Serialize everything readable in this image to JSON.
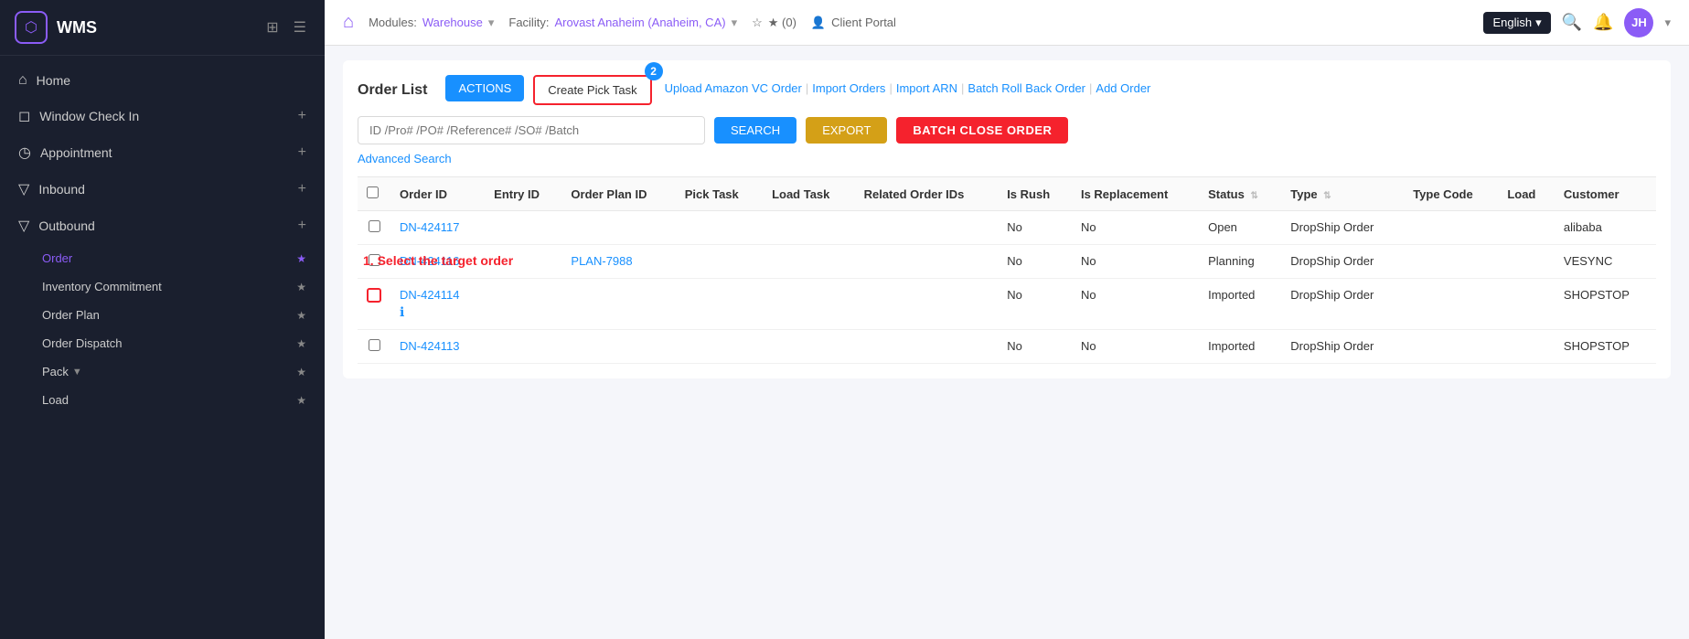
{
  "sidebar": {
    "logo_char": "⬡",
    "title": "WMS",
    "nav": [
      {
        "id": "home",
        "icon": "⌂",
        "label": "Home",
        "type": "item"
      },
      {
        "id": "window-check-in",
        "icon": "◻",
        "label": "Window Check In",
        "type": "item-plus"
      },
      {
        "id": "appointment",
        "icon": "◷",
        "label": "Appointment",
        "type": "item-plus"
      },
      {
        "id": "inbound",
        "icon": "▽",
        "label": "Inbound",
        "type": "item-plus"
      },
      {
        "id": "outbound",
        "icon": "▽",
        "label": "Outbound",
        "type": "item-plus"
      }
    ],
    "outbound_children": [
      {
        "id": "order",
        "label": "Order",
        "active": true
      },
      {
        "id": "inventory-commitment",
        "label": "Inventory Commitment"
      },
      {
        "id": "order-plan",
        "label": "Order Plan"
      },
      {
        "id": "order-dispatch",
        "label": "Order Dispatch"
      },
      {
        "id": "pack",
        "label": "Pack",
        "has_arrow": true
      },
      {
        "id": "load",
        "label": "Load"
      }
    ]
  },
  "topbar": {
    "modules_label": "Modules:",
    "module_name": "Warehouse",
    "facility_label": "Facility:",
    "facility_name": "Arovast Anaheim (Anaheim, CA)",
    "favorites": "★ (0)",
    "client_portal": "Client Portal",
    "language": "English",
    "avatar": "JH"
  },
  "page": {
    "title": "Order List",
    "actions_label": "ACTIONS",
    "create_pick_task_label": "Create Pick Task",
    "links": [
      "Upload Amazon VC Order",
      "Import Orders",
      "Import ARN",
      "Batch Roll Back Order",
      "Add Order"
    ],
    "search_placeholder": "ID /Pro# /PO# /Reference# /SO# /Batch",
    "search_btn": "SEARCH",
    "export_btn": "EXPORT",
    "batch_close_btn": "BATCH CLOSE ORDER",
    "advanced_search": "Advanced Search",
    "create_pick_badge": "2",
    "step1_label": "1. Select the target order",
    "step2_label": "2"
  },
  "table": {
    "columns": [
      "Order ID",
      "Entry ID",
      "Order Plan ID",
      "Pick Task",
      "Load Task",
      "Related Order IDs",
      "Is Rush",
      "Is Replacement",
      "Status",
      "Type",
      "Type Code",
      "Load",
      "Customer"
    ],
    "rows": [
      {
        "order_id": "DN-424117",
        "entry_id": "",
        "order_plan_id": "",
        "pick_task": "",
        "load_task": "",
        "related_order_ids": "",
        "is_rush": "No",
        "is_replacement": "No",
        "status": "Open",
        "type": "DropShip Order",
        "type_code": "",
        "load": "",
        "customer": "alibaba",
        "has_info": false,
        "highlighted": false
      },
      {
        "order_id": "DN-424116",
        "entry_id": "",
        "order_plan_id": "PLAN-7988",
        "pick_task": "",
        "load_task": "",
        "related_order_ids": "",
        "is_rush": "No",
        "is_replacement": "No",
        "status": "Planning",
        "type": "DropShip Order",
        "type_code": "",
        "load": "",
        "customer": "VESYNC",
        "has_info": false,
        "highlighted": false
      },
      {
        "order_id": "DN-424114",
        "entry_id": "",
        "order_plan_id": "",
        "pick_task": "",
        "load_task": "",
        "related_order_ids": "",
        "is_rush": "No",
        "is_replacement": "No",
        "status": "Imported",
        "type": "DropShip Order",
        "type_code": "",
        "load": "",
        "customer": "SHOPSTOP",
        "has_info": true,
        "highlighted": true
      },
      {
        "order_id": "DN-424113",
        "entry_id": "",
        "order_plan_id": "",
        "pick_task": "",
        "load_task": "",
        "related_order_ids": "",
        "is_rush": "No",
        "is_replacement": "No",
        "status": "Imported",
        "type": "DropShip Order",
        "type_code": "",
        "load": "",
        "customer": "SHOPSTOP",
        "has_info": false,
        "highlighted": false
      }
    ]
  },
  "colors": {
    "accent_purple": "#8b5cf6",
    "accent_blue": "#1890ff",
    "btn_red": "#f5222d",
    "btn_gold": "#d4a017",
    "sidebar_bg": "#1a1f2e"
  }
}
